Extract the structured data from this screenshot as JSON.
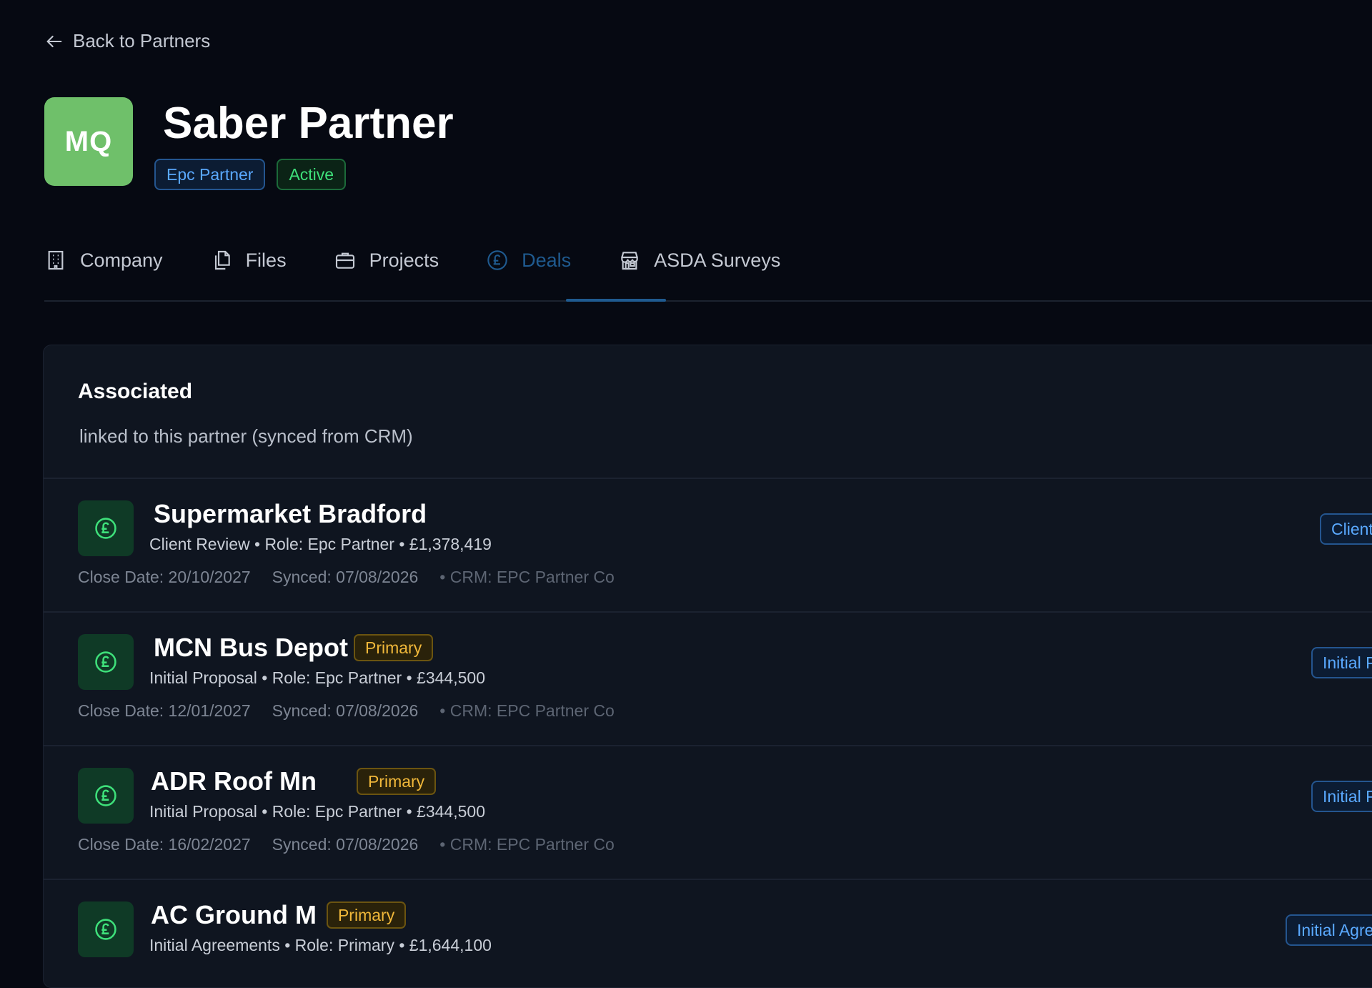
{
  "nav": {
    "back_label": "Back to Partners"
  },
  "partner": {
    "initials": "MQ",
    "name": "Saber Partner",
    "type_badge": "Epc Partner",
    "status_badge": "Active",
    "colors": {
      "avatar": "#6fc06a",
      "type": "#5aa9ff",
      "status": "#3ee07a"
    }
  },
  "tabs": [
    {
      "label": "Company",
      "icon": "building-icon"
    },
    {
      "label": "Files",
      "icon": "files-icon"
    },
    {
      "label": "Projects",
      "icon": "briefcase-icon"
    },
    {
      "label": "Deals",
      "icon": "pound-icon",
      "active": true
    },
    {
      "label": "ASDA Surveys",
      "icon": "store-icon"
    }
  ],
  "panel": {
    "title": "Associated",
    "subtitle": "linked to this partner (synced from CRM)"
  },
  "deals": [
    {
      "title": "Supermarket Bradford",
      "primary_badge": "",
      "meta": "Client Review • Role: Epc Partner • £1,378,419",
      "close_date": "Close Date: 20/10/2027",
      "synced": "Synced: 07/08/2026",
      "crm": "• CRM: EPC Partner Co",
      "stage": "Client"
    },
    {
      "title": "MCN Bus Depot",
      "primary_badge": "Primary",
      "meta": "Initial Proposal • Role: Epc Partner • £344,500",
      "close_date": "Close Date: 12/01/2027",
      "synced": "Synced: 07/08/2026",
      "crm": "• CRM: EPC Partner Co",
      "stage": "Initial P"
    },
    {
      "title": "ADR Roof Mn",
      "primary_badge": "Primary",
      "meta": "Initial Proposal • Role: Epc Partner • £344,500",
      "close_date": "Close Date: 16/02/2027",
      "synced": "Synced: 07/08/2026",
      "crm": "• CRM: EPC Partner Co",
      "stage": "Initial P"
    },
    {
      "title": "AC Ground M",
      "primary_badge": "Primary",
      "meta": "Initial Agreements • Role: Primary • £1,644,100",
      "close_date": "",
      "synced": "",
      "crm": "",
      "stage": "Initial Agre"
    }
  ]
}
